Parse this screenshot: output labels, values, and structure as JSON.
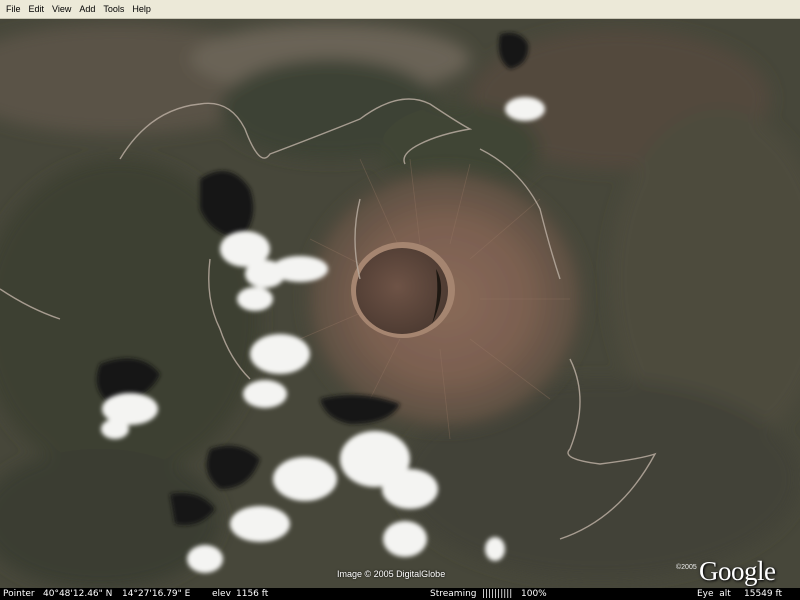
{
  "menu": {
    "items": [
      {
        "label": "File"
      },
      {
        "label": "Edit"
      },
      {
        "label": "View"
      },
      {
        "label": "Add"
      },
      {
        "label": "Tools"
      },
      {
        "label": "Help"
      }
    ]
  },
  "map": {
    "imagery_credit": "Image © 2005 DigitalGlobe",
    "copyright": "©2005",
    "logo_text": "Google"
  },
  "status": {
    "pointer_label": "Pointer",
    "latitude": "40°48'12.46\" N",
    "longitude": "14°27'16.79\" E",
    "elev_label": "elev",
    "elevation": "1156 ft",
    "streaming_label": "Streaming",
    "streaming_bar": "||||||||||",
    "streaming_percent": "100%",
    "eye_alt_label": "Eye  alt",
    "eye_alt": "15549 ft"
  },
  "colors": {
    "terrain": "#4a4a3a",
    "crater_rim": "#8a6a58",
    "crater_floor": "#6e5346"
  }
}
